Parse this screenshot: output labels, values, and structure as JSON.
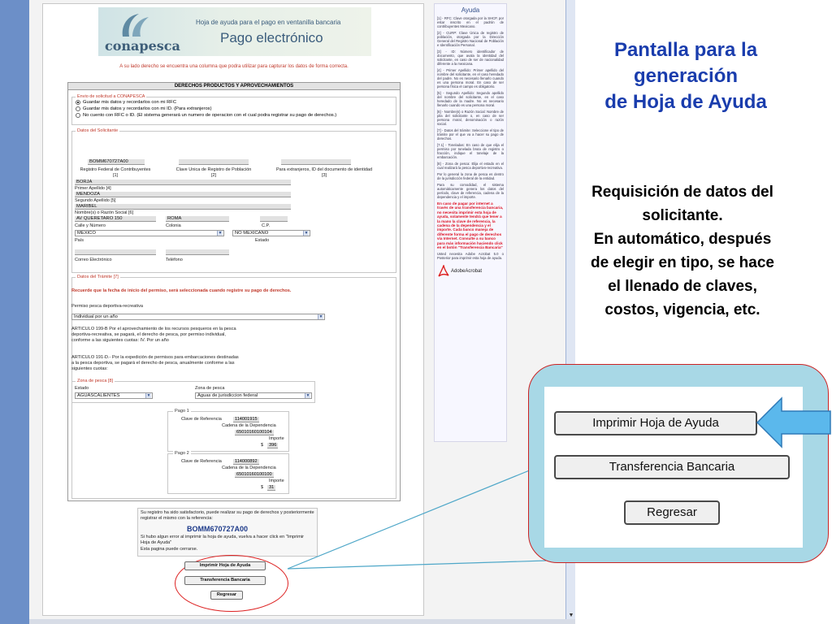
{
  "form": {
    "logo_text": "conapesca",
    "banner_subtitle": "Hoja de ayuda para el pago en ventanilla bancaria",
    "banner_title": "Pago electrónico",
    "notice": "A su lado derecho se encuentra una columna que podra utilizar para capturar los datos de forma correcta.",
    "panel_title": "DERECHOS PRODUCTOS Y APROVECHAMIENTOS",
    "envio": {
      "legend": "Envio de solicitud a CONAPESCA",
      "options": [
        "Guardar mis datos y recordarlos con mi RFC",
        "Guardar mis datos y recordarlos con mi ID. (Para extranjeros)",
        "No cuento con RFC o ID. (El sistema generará un numero de operacion con el cual podra registrar su pago de derechos.)"
      ]
    },
    "solicitante": {
      "legend": "Datos del Solicitante",
      "rfc_value": "BOMM670727A00",
      "rfc_label": "Registro Federal de Contribuyentes",
      "rfc_num": "[1]",
      "curp_label": "Clave Unica de Registro de Población",
      "curp_num": "[2]",
      "id_label": "Para extranjeros, ID del documento de identidad",
      "id_num": "[3]",
      "nombre": "BORJA",
      "ap1_label": "Primer Apellido [4]",
      "ap1": "MENDOZA",
      "ap2_label": "Segundo Apellido [5]",
      "ap2": "MARIBEL",
      "razon_label": "Nombre(s) o Razón Social [6]",
      "calle": "AV QUERETARO 150",
      "colonia": "ROMA",
      "calle_label": "Calle y Número",
      "colonia_label": "Colonia",
      "cp_label": "C.P.",
      "pais": "MEXICO",
      "estado": "NO MEXICANO",
      "pais_label": "País",
      "estado_label": "Estado",
      "correo_label": "Correo Electrónico",
      "telefono_label": "Teléfono"
    },
    "tramite": {
      "legend": "Datos del Trámite [7]",
      "red_notice": "Recuerde que la fecha de inicio del permiso, será seleccionada cuando registre su pago de derechos.",
      "permiso_label": "Permiso pesca deportiva-recreativa",
      "permiso_value": "Individual por un año",
      "art199": "ARTICULO 199-B Por el aprovechamiento de los recursos pesqueros en la pesca deportiva-recreativa, se pagará, el derecho de pesca, por permiso individual, conforme a las siguientes cuotas: IV. Por un año",
      "art191": "ARTICULO 191-D.- Por la expedición de permisos para embarcaciones destinadas a la pesca deportiva, se pagará el derecho de pesca, anualmente conforme a las siguientes cuotas:"
    },
    "zona": {
      "legend": "Zona de pesca [8]",
      "estado_label": "Estado",
      "estado": "AGUASCALIENTES",
      "zona_label": "Zona de pesca",
      "zona": "Aguas de jurisdiccion federal"
    },
    "pago1": {
      "legend": "Pago 1",
      "clave_label": "Clave de Referencia",
      "clave": "114001915",
      "cadena_label": "Cadena de la Dependencia",
      "cadena": "65010160100104",
      "importe_label": "Importe",
      "currency": "$",
      "importe": "396"
    },
    "pago2": {
      "legend": "Pago 2",
      "clave_label": "Clave de Referencia",
      "clave": "114000892",
      "cadena_label": "Cadena de la Dependencia",
      "cadena": "65010160100100",
      "importe_label": "Importe",
      "currency": "$",
      "importe": "31"
    },
    "success": {
      "line1": "Su registro ha sido satisfactorio, puede realizar su pago de derechos y posteriormente registrar el mismo con la referencia:",
      "reference": "BOMM670727A00",
      "line2": "Si hubo algun error al imprimir la hoja de ayuda, vuelva a hacer click en \"Imprimir Hoja de Ayuda\"",
      "line3": "Esta pagina puede cerrarse."
    },
    "buttons": {
      "print": "Imprimir Hoja de Ayuda",
      "transfer": "Transferencia Bancaria",
      "back": "Regresar"
    }
  },
  "help": {
    "title": "Ayuda",
    "paragraphs": [
      "[1] - RFC: Clave otorgada por la SHCP, por estar inscrito en el padrón de contribuyentes Mexicano.",
      "[2] - CURP: Clave Única de registro de población, otorgada por la Dirección General del Registro Nacional de Población e Identificación Personal.",
      "[3] - ID: Número identificador de documento, que avala la identidad del solicitante, en caso de ser de nacionalidad diferente a la mexicana.",
      "[4] - Primer Apellido: Primer apellido del nombre del solicitante, en el caso heredado del padre. No es necesario llenarlo cuando es una persona moral. En caso de ser persona física el campo es obligatorio.",
      "[5] - Segundo Apellido: Segundo apellido del nombre del solicitante, en el caso heredado de la madre. No es necesario llenarlo cuando es una persona moral.",
      "[6] - Nombre(s) o Razón Social: Nombre de pila del solicitante o, en caso de ser persona moral, denominación o razón social.",
      "[7] - Datos del trámite: Seleccione el tipo de trámite por el que va a hacer su pago de derechos.",
      "[7.1] - Toneladas: En caso de que elija el permiso por tonelada bruta de registro o fracción, indique el tonelaje de la embarcación.",
      "[8] - Zona de pesca: Elija el estado en el cual realizará la pesca deportivo-recreativa.",
      "Por lo general la zona de pesca es dentro de la jurisdicción federal de la entidad.",
      "Para su comodidad, el sistema automáticamente genera los datos del período, clave de referencia, cadena de la dependencia y el importe."
    ],
    "red_paragraph": "En caso de pagar por internet a través de una transferencia bancaria, no necesita imprimir esta hoja de ayuda, solamente tendrá que tener a la mano la clave de referencia, la cadena de la dependencia y el importe. Cada banco maneja de diferente forma el pago de derechos vía Internet. Consulte a su banco para más información haciendo click en el botón \"Transferencia Bancaria\"",
    "adobe_note": "Usted necesita Adobe Acrobat 5.0 o Posterior para imprimir esta hoja de ayuda.",
    "adobe_logo": "AdobeAcrobat"
  },
  "annotation": {
    "title_lines": [
      "Pantalla para la",
      "generación",
      "de Hoja de Ayuda"
    ],
    "body_lines": [
      "Requisición de datos del",
      "solicitante.",
      "En automático, después",
      "de elegir en tipo, se hace",
      "el llenado de claves,",
      "costos, vigencia, etc."
    ],
    "zoom_buttons": {
      "print": "Imprimir Hoja de Ayuda",
      "transfer": "Transferencia Bancaria",
      "back": "Regresar"
    }
  },
  "colors": {
    "annotation_title": "#1a3dad",
    "zoom_bg": "#a8d8e6",
    "arrow": "#5bb8ec",
    "red_outline": "#cc2222"
  }
}
